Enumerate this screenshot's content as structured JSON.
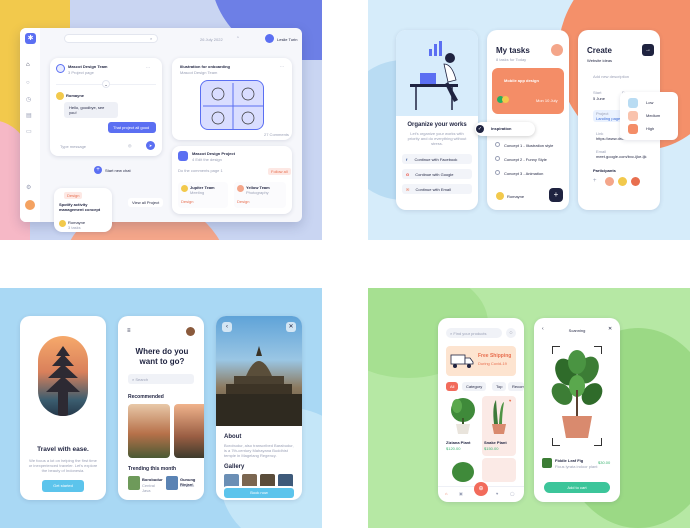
{
  "dashboard": {
    "user_name": "Leslie Turin",
    "search_date": "26 July 2022",
    "project_card": {
      "title": "Mascot Design Team",
      "subtitle": "3 Project page"
    },
    "chat": {
      "username": "Romayne",
      "message": "Hello, goodbye, see you!",
      "reply": "That project all good",
      "input_placeholder": "Type message"
    },
    "start_chat": "Start new chat",
    "popup": {
      "tag": "Design",
      "title": "Spotify activity management concept",
      "member": "Romayne",
      "member_sub": "3 tasks"
    },
    "view_all_project": "View all Project",
    "illustration_card": {
      "title": "Illustration for onboarding",
      "subtitle": "Mascot Design Team"
    },
    "video": {
      "title": "Mascot Design Project",
      "subtitle": "4 Edit the design",
      "comments": "27 Comments",
      "comment_text": "Do the comments page 1",
      "follow": "Follow all"
    },
    "small_cards": [
      {
        "name": "Jupiter Team",
        "sub": "Meeting",
        "tag": "Design"
      },
      {
        "name": "Yellow Team",
        "sub": "Photography",
        "tag": "Design"
      }
    ]
  },
  "tasks_app": {
    "onboard": {
      "title": "Organize your works",
      "subtitle": "Let's organize your works with priority and do everything without stress.",
      "buttons": [
        "Continue with Facebook",
        "Continue with Google",
        "Continue with Email"
      ]
    },
    "my_tasks": {
      "title": "My tasks",
      "date": "8 tasks for Today",
      "highlight": "Mobile app design",
      "highlight_date": "Mon 10 July",
      "popup_text": "Inspiration",
      "items": [
        "Concept 1 - Illustration style",
        "Concept 2 - Funny Style",
        "Concept 3 - Animation"
      ],
      "footer_user": "Romayne"
    },
    "create": {
      "title": "Create",
      "selector": "Website ideas",
      "field_placeholder": "Add new description",
      "start_label": "Start",
      "start_value": "5 June",
      "due_label": "Due",
      "due_value": "Today",
      "priority": [
        "Low",
        "Medium",
        "High"
      ],
      "selected_priority": "Medium",
      "project_label": "Project",
      "project_value": "Landing page for MeetSkills",
      "link_label": "Link",
      "link_value": "https://www.dribbble.com/",
      "email_label": "Email",
      "email_value": "meet.google.com/bxc-ijke-ljk",
      "participants": "Participants"
    }
  },
  "travel_app": {
    "onboard_title": "Travel with ease.",
    "onboard_text": "We focus a lot on helping the first time or inexperienced traveler. Let's explore the beauty of Indonesia.",
    "get_started": "Get started",
    "question": "Where do you want to go?",
    "search_placeholder": "Search",
    "recommended": "Recommended",
    "trending": "Trending this month",
    "trend_items": [
      {
        "name": "Borobudur",
        "sub": "Central Java"
      },
      {
        "name": "Gunung Rinjani",
        "sub": "Lombok"
      }
    ],
    "about": "About",
    "about_text": "Borobudur, also transcribed Barabudur, is a 7th-century Mahayana Buddhist temple in Magelang Regency.",
    "gallery": "Gallery",
    "book_now": "Book now"
  },
  "plant_app": {
    "search_placeholder": "Find your products",
    "promo_title": "Free Shipping",
    "promo_sub": "During Covid-19",
    "categories": [
      "All",
      "Category",
      "Top",
      "Recommended"
    ],
    "products": [
      {
        "name": "Ziziana Plant",
        "price": "$120.00"
      },
      {
        "name": "Snake Plant",
        "price": "$150.00"
      }
    ],
    "scan_title": "Scanning",
    "result_name": "Fiddle Leaf Fig",
    "result_sub": "Ficus lyrata indoor plant",
    "result_price": "$30.00",
    "add_cart": "Add to cart"
  }
}
